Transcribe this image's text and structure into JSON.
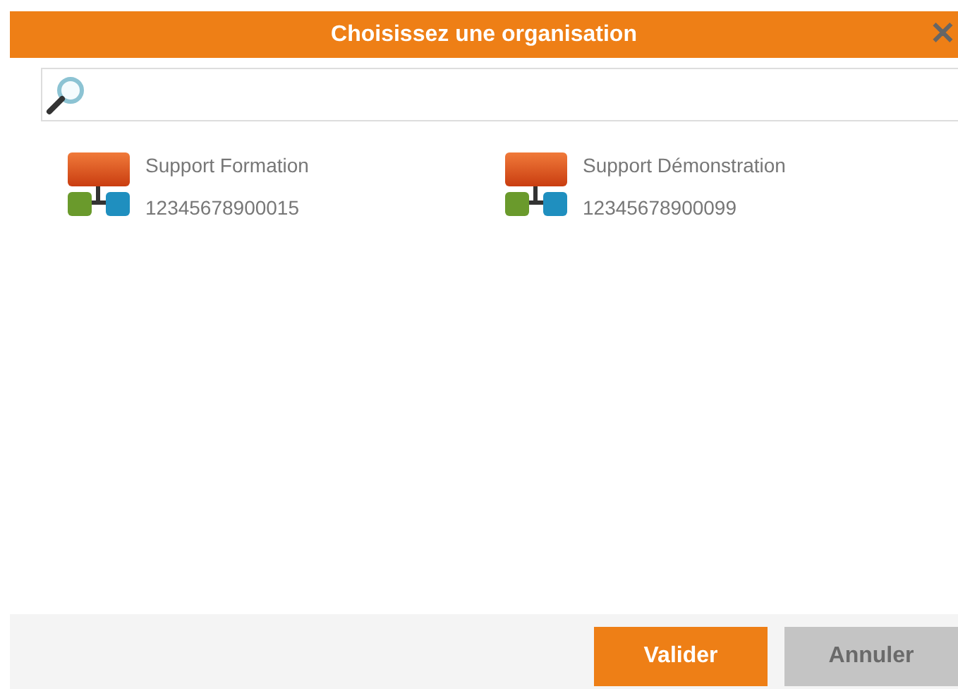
{
  "dialog": {
    "title": "Choisissez une organisation",
    "close": "✕"
  },
  "organizations": [
    {
      "name": "Support Formation",
      "number": "12345678900015"
    },
    {
      "name": "Support Démonstration",
      "number": "12345678900099"
    }
  ],
  "buttons": [
    {
      "label": "Valider",
      "disabled": false
    },
    {
      "label": "Annuler",
      "disabled": true
    }
  ]
}
